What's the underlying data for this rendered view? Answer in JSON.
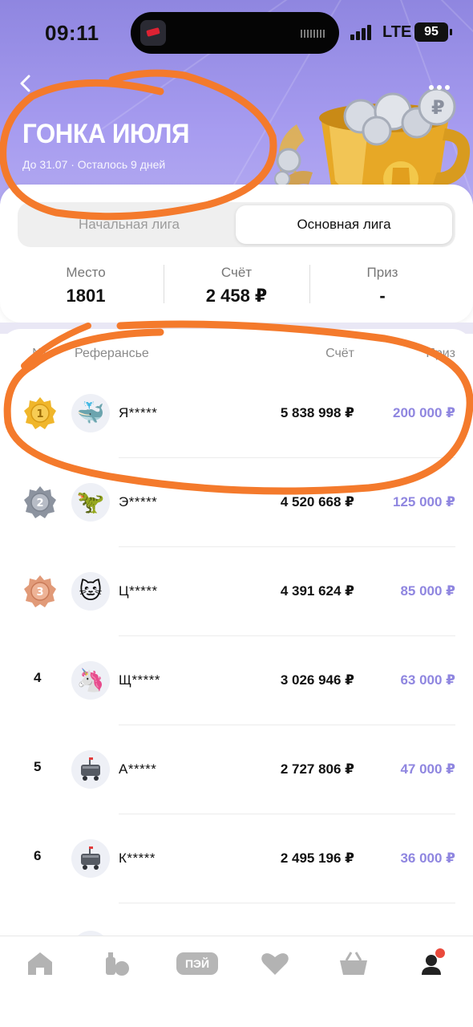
{
  "status_bar": {
    "time": "09:11",
    "network": "LTE",
    "battery": "95"
  },
  "header": {
    "title": "ГОНКА ИЮЛЯ",
    "subtitle": "До 31.07 · Осталось 9 дней"
  },
  "league_tabs": [
    {
      "label": "Начальная лига",
      "selected": false
    },
    {
      "label": "Основная лига",
      "selected": true
    }
  ],
  "stats": {
    "place_label": "Место",
    "place_value": "1801",
    "score_label": "Счёт",
    "score_value": "2 458 ₽",
    "prize_label": "Приз",
    "prize_value": "-"
  },
  "table": {
    "col_rank": "№",
    "col_name": "Реферансье",
    "col_score": "Счёт",
    "col_prize": "Приз",
    "rows": [
      {
        "rank": "1",
        "avatar": "🐳",
        "name": "Я*****",
        "score": "5 838 998 ₽",
        "prize": "200 000 ₽",
        "medal": "gold"
      },
      {
        "rank": "2",
        "avatar": "🦖",
        "name": "Э*****",
        "score": "4 520 668 ₽",
        "prize": "125 000 ₽",
        "medal": "silver"
      },
      {
        "rank": "3",
        "avatar": "🐱",
        "name": "Ц*****",
        "score": "4 391 624 ₽",
        "prize": "85 000 ₽",
        "medal": "bronze"
      },
      {
        "rank": "4",
        "avatar": "🦄",
        "name": "Щ*****",
        "score": "3 026 946 ₽",
        "prize": "63 000 ₽"
      },
      {
        "rank": "5",
        "avatar": "robot",
        "name": "А*****",
        "score": "2 727 806 ₽",
        "prize": "47 000 ₽"
      },
      {
        "rank": "6",
        "avatar": "robot",
        "name": "К*****",
        "score": "2 495 196 ₽",
        "prize": "36 000 ₽"
      }
    ]
  },
  "tabbar": {
    "pay_label": "ПЭЙ",
    "icons": [
      "home-icon",
      "groceries-icon",
      "pay-icon",
      "heart-icon",
      "basket-icon",
      "profile-icon"
    ],
    "active": "profile-icon"
  },
  "colors": {
    "accent": "#8f86e0",
    "orange_marker": "#f47a2c"
  }
}
